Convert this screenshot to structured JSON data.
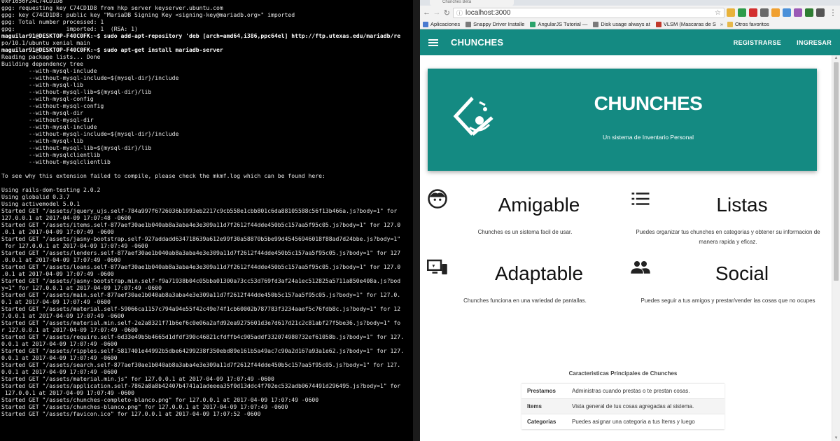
{
  "terminal": {
    "lines": [
      "0xF1656F24C74CD1D8",
      "gpg: requesting key C74CD1D8 from hkp server keyserver.ubuntu.com",
      "gpg: key C74CD1D8: public key \"MariaDB Signing Key <signing-key@mariadb.org>\" imported",
      "gpg: Total number processed: 1",
      "gpg:               imported: 1  (RSA: 1)",
      "maguilar91@DESKTOP-F40C0FK:~$ sudo add-apt-repository 'deb [arch=amd64,i386,ppc64el] http://ftp.utexas.edu/mariadb/re",
      "po/10.1/ubuntu xenial main",
      "maguilar91@DESKTOP-F40C0FK:~$ sudo apt-get install mariadb-server",
      "Reading package lists... Done",
      "Building dependency tree",
      "        --with-mysql-include",
      "        --without-mysql-include=${mysql-dir}/include",
      "        --with-mysql-lib",
      "        --without-mysql-lib=${mysql-dir}/lib",
      "        --with-mysql-config",
      "        --without-mysql-config",
      "        --with-mysql-dir",
      "        --without-mysql-dir",
      "        --with-mysql-include",
      "        --without-mysql-include=${mysql-dir}/include",
      "        --with-mysql-lib",
      "        --without-mysql-lib=${mysql-dir}/lib",
      "        --with-mysqlclientlib",
      "        --without-mysqlclientlib",
      "",
      "To see why this extension failed to compile, please check the mkmf.log which can be found here:",
      "",
      "Using rails-dom-testing 2.0.2",
      "Using globalid 0.3.7",
      "Using activemodel 5.0.1",
      "Started GET \"/assets/jquery_ujs.self-784a997f6726036b1993eb2217c9cb558e1cbb801c6da88105588c56f13b466a.js?body=1\" for",
      "127.0.0.1 at 2017-04-09 17:07:48 -0600",
      "Started GET \"/assets/items.self-877aef30ae1b040ab8a3aba4e3e309a11d7f2612f44dde450b5c157aa5f95c05.js?body=1\" for 127.0",
      ".0.1 at 2017-04-09 17:07:49 -0600",
      "Started GET \"/assets/jasny-bootstrap.self-927addadd634718639a612e99f30a58870b5be99d45456946018f88ad7d24bbe.js?body=1\"",
      " for 127.0.0.1 at 2017-04-09 17:07:49 -0600",
      "Started GET \"/assets/lenders.self-877aef30ae1b040ab8a3aba4e3e309a11d7f2612f44dde450b5c157aa5f95c05.js?body=1\" for 127",
      ".0.0.1 at 2017-04-09 17:07:49 -0600",
      "Started GET \"/assets/loans.self-877aef30ae1b040ab8a3aba4e3e309a11d7f2612f44dde450b5c157aa5f95c05.js?body=1\" for 127.0",
      ".0.1 at 2017-04-09 17:07:49 -0600",
      "Started GET \"/assets/jasny-bootstrap.min.self-f9a71938b04c05bba01300a73cc53d769fd3af24a1ec512825a5711a850e408a.js?bod",
      "y=1\" for 127.0.0.1 at 2017-04-09 17:07:49 -0600",
      "Started GET \"/assets/main.self-877aef30ae1b040ab8a3aba4e3e309a11d7f2612f44dde450b5c157aa5f95c05.js?body=1\" for 127.0.",
      "0.1 at 2017-04-09 17:07:49 -0600",
      "Started GET \"/assets/material.self-59066ca1157c794a94e55f42c49e74f1cb60002b787783f3234aaef5c76fdb8c.js?body=1\" for 12",
      "7.0.0.1 at 2017-04-09 17:07:49 -0600",
      "Started GET \"/assets/material.min.self-2e2a8321f71b6ef6c0e06a2afd92ea9275601d3e7d617d21c2c81abf27f5be36.js?body=1\" fo",
      "r 127.0.0.1 at 2017-04-09 17:07:49 -0600",
      "Started GET \"/assets/require.self-6d33e49b5b4665d1dfdf390c46821cfdffb4c905addf332074980732ef61058b.js?body=1\" for 127.",
      "0.0.1 at 2017-04-09 17:07:49 -0600",
      "Started GET \"/assets/ripples.self-5817401e44992b5dbe64299238f350ebd89e161b5a49ac7c90a2d167a93a1e62.js?body=1\" for 127.",
      "0.0.1 at 2017-04-09 17:07:49 -0600",
      "Started GET \"/assets/search.self-877aef30ae1b040ab8a3aba4e3e309a11d7f2612f44dde450b5c157aa5f95c05.js?body=1\" for 127.",
      "0.0.1 at 2017-04-09 17:07:49 -0600",
      "Started GET \"/assets/material.min.js\" for 127.0.0.1 at 2017-04-09 17:07:49 -0600",
      "Started GET \"/assets/application.self-7862a8a8b42407b4741a1adeeea35f0d13ddc4f702ec532adb0674491d296495.js?body=1\" for",
      " 127.0.0.1 at 2017-04-09 17:07:49 -0600",
      "Started GET \"/assets/chunches-completo-blanco.png\" for 127.0.0.1 at 2017-04-09 17:07:49 -0600",
      "Started GET \"/assets/chunches-blanco.png\" for 127.0.0.1 at 2017-04-09 17:07:49 -0600",
      "Started GET \"/assets/favicon.ico\" for 127.0.0.1 at 2017-04-09 17:07:52 -0600"
    ]
  },
  "browser": {
    "tab_title": "Chunches Beta",
    "url": "localhost:3000",
    "bookmarks": [
      {
        "label": "Aplicaciones",
        "color": "#4a7bd0"
      },
      {
        "label": "Snappy Driver Installe",
        "color": "#7a7a7a"
      },
      {
        "label": "AngularJS Tutorial —",
        "color": "#2aa36b"
      },
      {
        "label": "Disk usage always at",
        "color": "#7a7a7a"
      },
      {
        "label": "VLSM (Mascaras de S",
        "color": "#c0392b"
      }
    ],
    "bookmarks_more": "»",
    "other_bookmarks": "Otros favoritos",
    "extensions": [
      "#e8b23a",
      "#2e9b4b",
      "#d32f2f",
      "#6a6a6a",
      "#f0a030",
      "#4a90d9",
      "#9b59b6",
      "#2e7d32",
      "#555555"
    ]
  },
  "app": {
    "brand": "CHUNCHES",
    "nav": {
      "register": "REGISTRARSE",
      "login": "INGRESAR"
    },
    "hero": {
      "title": "CHUNCHES",
      "subtitle": "Un sistema de Inventario Personal"
    },
    "features": [
      {
        "title": "Amigable",
        "desc": "Chunches es un sistema facil de usar.",
        "icon": "face-icon"
      },
      {
        "title": "Listas",
        "desc": "Puedes organizar tus chunches en categorias y obtener su informacion de manera rapida y eficaz.",
        "icon": "list-icon"
      },
      {
        "title": "Adaptable",
        "desc": "Chunches funciona en una variedad de pantallas.",
        "icon": "devices-icon"
      },
      {
        "title": "Social",
        "desc": "Puedes seguir a tus amigos y prestar/vender las cosas que no ocupes",
        "icon": "people-icon"
      }
    ],
    "table": {
      "title": "Caracteristicas Principales de Chunches",
      "rows": [
        {
          "key": "Prestamos",
          "value": "Administras cuando prestas o te prestan cosas."
        },
        {
          "key": "Items",
          "value": "Vista general de tus cosas agregadas al sistema."
        },
        {
          "key": "Categorias",
          "value": "Puedes asignar una categoria a tus Items y luego"
        }
      ]
    },
    "colors": {
      "primary": "#148a82"
    }
  }
}
